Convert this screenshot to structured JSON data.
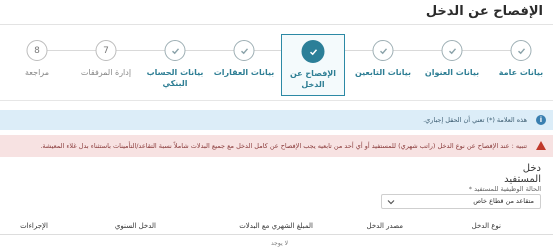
{
  "page": {
    "title": "الإفصاح عن الدخل"
  },
  "steps": [
    {
      "label": "بيانات عامة",
      "state": "done",
      "number": ""
    },
    {
      "label": "بيانات العنوان",
      "state": "done",
      "number": ""
    },
    {
      "label": "بيانات التابعين",
      "state": "done",
      "number": ""
    },
    {
      "label": "الإفصاح عن الدخل",
      "state": "active",
      "number": ""
    },
    {
      "label": "بيانات العقارات",
      "state": "done",
      "number": ""
    },
    {
      "label": "بيانات الحساب البنكي",
      "state": "done",
      "number": ""
    },
    {
      "label": "إدارة المرفقات",
      "state": "pending",
      "number": "7"
    },
    {
      "label": "مراجعة",
      "state": "pending",
      "number": "8"
    }
  ],
  "alerts": {
    "info": "هذه العلامة (*) تعني أن الحقل إجباري.",
    "danger": "تنبيه : عند الإفصاح عن نوع الدخل (راتب شهري) للمستفيد أو أي أحد من تابعيه يجب الإفصاح عن كامل الدخل مع جميع البدلات شاملاً نسبة التقاعد/التأمينات باستثناء بدل غلاء المعيشة."
  },
  "beneficiary": {
    "section_title": "دخل",
    "section_subtitle": "المستفيد",
    "employment_label": "الحالة الوظيفية للمستفيد *",
    "employment_value": "متقاعد من قطاع خاص"
  },
  "table": {
    "headers": [
      "نوع الدخل",
      "مصدر الدخل",
      "المبلغ الشهري مع البدلات",
      "الدخل السنوي",
      "الإجراءات"
    ],
    "empty_text": "لا يوجد"
  },
  "colors": {
    "accent": "#2c7f98",
    "info_bg": "#dcedf8",
    "danger_bg": "#f7e2e2"
  }
}
